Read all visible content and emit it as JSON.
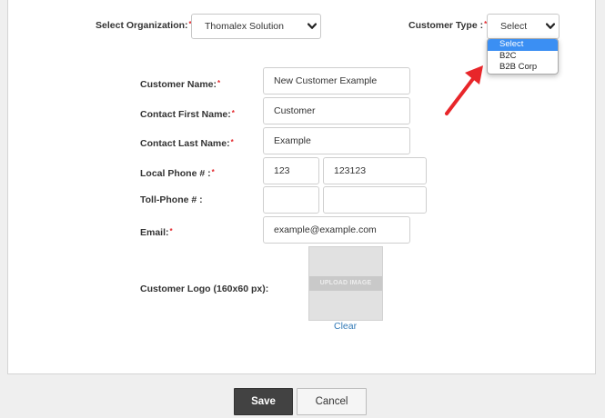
{
  "organization": {
    "label": "Select Organization:",
    "required": "*",
    "value": "Thomalex Solution"
  },
  "customer_type": {
    "label": "Customer Type :",
    "required": "*",
    "value": "Select",
    "options": [
      "Select",
      "B2C",
      "B2B Corp"
    ]
  },
  "fields": {
    "customer_name": {
      "label": "Customer Name:",
      "required": "*",
      "value": "New Customer Example"
    },
    "contact_first_name": {
      "label": "Contact First Name:",
      "required": "*",
      "value": "Customer"
    },
    "contact_last_name": {
      "label": "Contact Last Name:",
      "required": "*",
      "value": "Example"
    },
    "local_phone": {
      "label": "Local Phone # :",
      "required": "*",
      "area": "123",
      "number": "123123"
    },
    "toll_phone": {
      "label": "Toll-Phone # :",
      "area": "",
      "number": ""
    },
    "email": {
      "label": "Email:",
      "required": "*",
      "value": "example@example.com"
    }
  },
  "logo": {
    "label": "Customer Logo (160x60 px):",
    "upload_text": "UPLOAD IMAGE",
    "clear_label": "Clear"
  },
  "buttons": {
    "save": "Save",
    "cancel": "Cancel"
  },
  "colors": {
    "accent": "#3b8ff3",
    "required": "#e3262b",
    "save_bg": "#424242",
    "arrow": "#e8262a",
    "link": "#337ab7"
  },
  "icons": {
    "select_chevron": "chevron-down-icon",
    "annotation_arrow": "red-arrow-icon"
  }
}
